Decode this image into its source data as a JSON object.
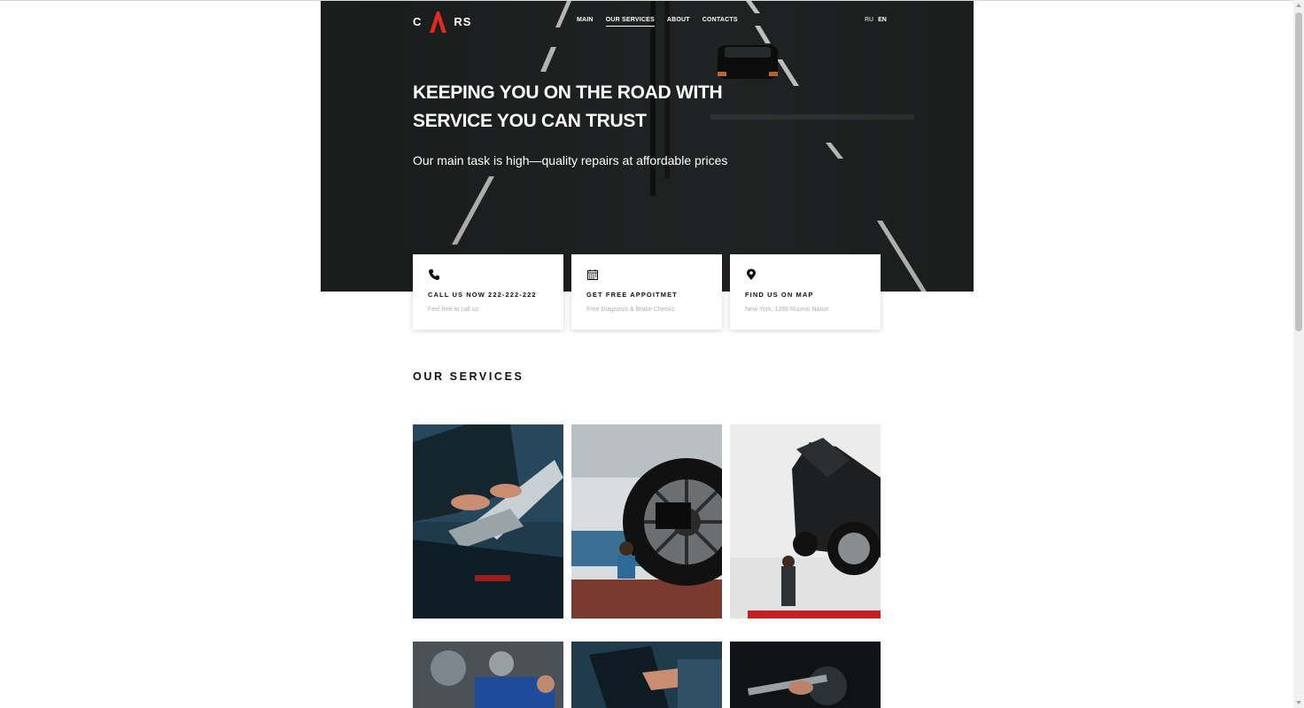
{
  "header": {
    "logo_text_left": "C",
    "logo_text_right": "RS",
    "nav": [
      {
        "label": "MAIN",
        "active": false
      },
      {
        "label": "OUR SERVICES",
        "active": true
      },
      {
        "label": "ABOUT",
        "active": false
      },
      {
        "label": "CONTACTS",
        "active": false
      }
    ],
    "languages": [
      {
        "label": "RU",
        "active": false
      },
      {
        "label": "EN",
        "active": true
      }
    ]
  },
  "hero": {
    "title": "KEEPING YOU ON THE ROAD WITH SERVICE YOU CAN TRUST",
    "subtitle": "Our main task is high—quality repairs at affordable prices"
  },
  "info_cards": [
    {
      "icon": "phone-icon",
      "title": "CALL US NOW 222-222-222",
      "text": "Feel free to call us"
    },
    {
      "icon": "calendar-icon",
      "title": "GET FREE APPOITMET",
      "text": "Free Diagnosis & Brake Checks"
    },
    {
      "icon": "map-pin-icon",
      "title": "FIND US ON MAP",
      "text": "New York, 1286 Ruumu Nanor"
    }
  ],
  "services": {
    "title": "OUR SERVICES",
    "tiles": [
      {
        "image": "mechanic-laptop-photo"
      },
      {
        "image": "wheel-alignment-photo"
      },
      {
        "image": "car-on-lift-photo"
      },
      {
        "image": "engine-repair-photo"
      },
      {
        "image": "laptop-hand-photo"
      },
      {
        "image": "wrench-engine-photo"
      }
    ]
  },
  "colors": {
    "brand_red": "#e02b20",
    "text_dark": "#111111",
    "muted": "#b0b0b0"
  }
}
